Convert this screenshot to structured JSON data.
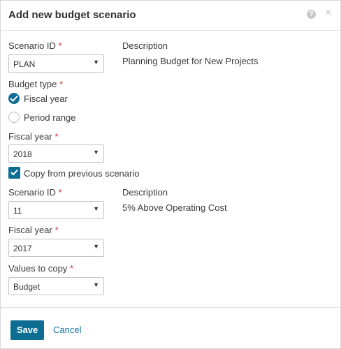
{
  "dialog": {
    "title": "Add new budget scenario",
    "help_icon": "question-circle-icon",
    "help_glyph": "?",
    "close_icon": "close-icon",
    "close_glyph": "×"
  },
  "form": {
    "required_marker": "*",
    "select_caret": "▼",
    "scenario_id": {
      "label": "Scenario ID",
      "value": "PLAN"
    },
    "description": {
      "label": "Description",
      "value": "Planning Budget for New Projects"
    },
    "budget_type": {
      "label": "Budget type",
      "options": [
        {
          "label": "Fiscal year",
          "selected": true
        },
        {
          "label": "Period range",
          "selected": false
        }
      ]
    },
    "fiscal_year": {
      "label": "Fiscal year",
      "value": "2018"
    },
    "copy_previous": {
      "label": "Copy from previous scenario",
      "checked": true
    },
    "source_scenario_id": {
      "label": "Scenario ID",
      "value": "11"
    },
    "source_description": {
      "label": "Description",
      "value": "5% Above Operating Cost"
    },
    "source_fiscal_year": {
      "label": "Fiscal year",
      "value": "2017"
    },
    "values_to_copy": {
      "label": "Values to copy",
      "value": "Budget"
    }
  },
  "footer": {
    "save_label": "Save",
    "cancel_label": "Cancel"
  },
  "colors": {
    "accent": "#0e6d92",
    "link": "#1a73a8",
    "required": "#d0342c"
  }
}
